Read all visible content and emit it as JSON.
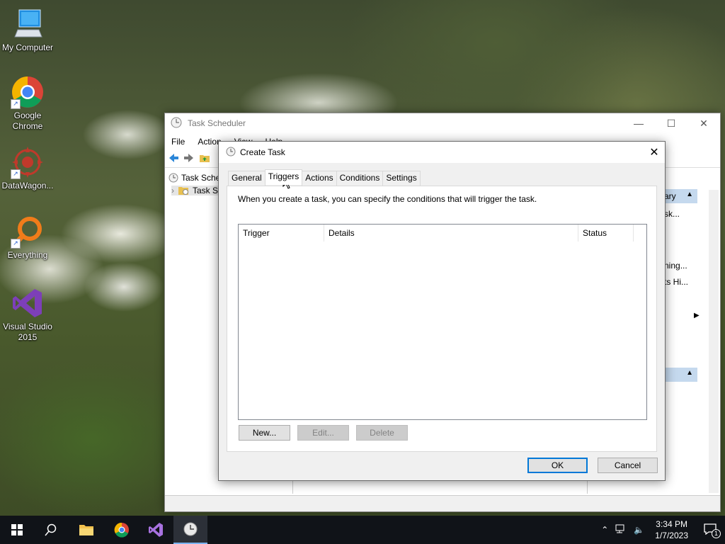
{
  "desktop": {
    "icons": [
      {
        "label": "My Computer"
      },
      {
        "label": "Google Chrome"
      },
      {
        "label": "DataWagon..."
      },
      {
        "label": "Everything"
      },
      {
        "label": "Visual Studio 2015"
      }
    ]
  },
  "task_scheduler": {
    "title": "Task Scheduler",
    "menu": [
      "File",
      "Action",
      "View",
      "Help"
    ],
    "tree": [
      "Task Sche",
      "Task S"
    ],
    "right_panel": [
      "ary",
      "sk...",
      "ning...",
      "ts Hi..."
    ]
  },
  "dialog": {
    "title": "Create Task",
    "tabs": [
      "General",
      "Triggers",
      "Actions",
      "Conditions",
      "Settings"
    ],
    "active_tab": "Triggers",
    "description": "When you create a task, you can specify the conditions that will trigger the task.",
    "columns": [
      "Trigger",
      "Details",
      "Status"
    ],
    "rows": [],
    "buttons": {
      "new": "New...",
      "edit": "Edit...",
      "delete": "Delete"
    },
    "ok": "OK",
    "cancel": "Cancel"
  },
  "taskbar": {
    "time": "3:34 PM",
    "date": "1/7/2023",
    "notification_count": "1"
  }
}
